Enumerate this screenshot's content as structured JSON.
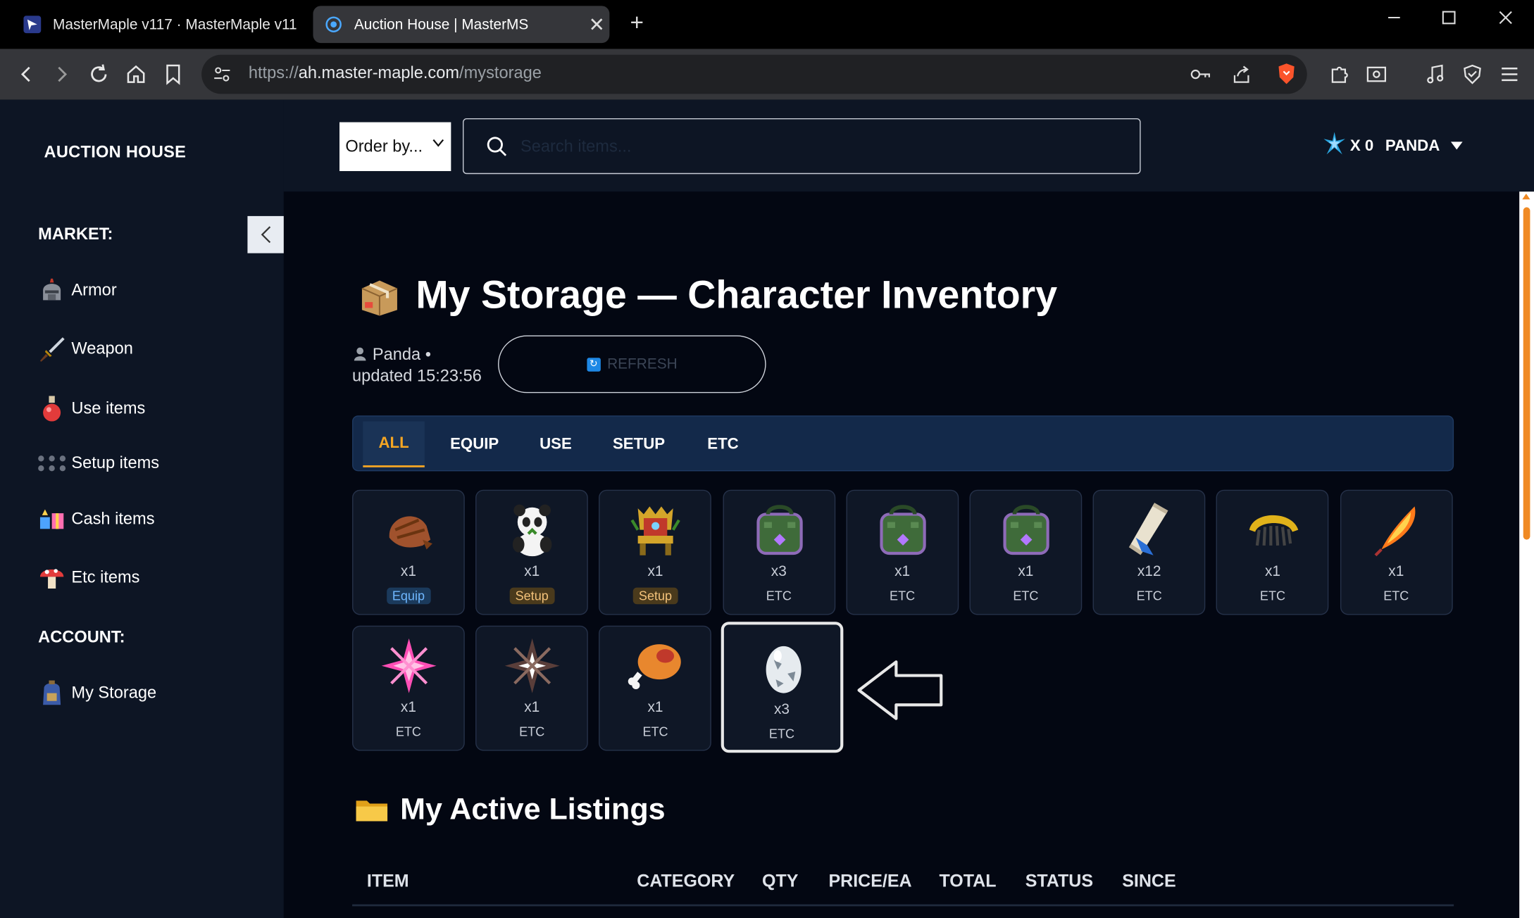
{
  "browser": {
    "tabs": [
      {
        "title": "MasterMaple v117 · MasterMaple v11"
      },
      {
        "title": "Auction House | MasterMS",
        "close": "✕"
      }
    ],
    "new_tab": "+",
    "url_scheme": "https://",
    "url_host": "ah.master-maple.com",
    "url_path": "/mystorage"
  },
  "sidebar": {
    "brand": "AUCTION HOUSE",
    "market_heading": "MARKET:",
    "market_items": [
      {
        "label": "Armor",
        "icon": "helmet-icon"
      },
      {
        "label": "Weapon",
        "icon": "sword-icon"
      },
      {
        "label": "Use items",
        "icon": "potion-icon"
      },
      {
        "label": "Setup items",
        "icon": "dots-icon"
      },
      {
        "label": "Cash items",
        "icon": "gift-icon"
      },
      {
        "label": "Etc items",
        "icon": "mushroom-icon"
      }
    ],
    "account_heading": "ACCOUNT:",
    "account_items": [
      {
        "label": "My Storage",
        "icon": "backpack-icon"
      }
    ]
  },
  "topbar": {
    "order_by": "Order by...",
    "search_placeholder": "Search items...",
    "currency_count": "X 0",
    "username": "PANDA"
  },
  "storage": {
    "title": "My Storage — Character Inventory",
    "character": "Panda",
    "updated": "updated 15:23:56",
    "refresh_label": "REFRESH",
    "filter_tabs": [
      "ALL",
      "EQUIP",
      "USE",
      "SETUP",
      "ETC"
    ],
    "active_tab": "ALL",
    "items": [
      {
        "qty": "x1",
        "category": "Equip",
        "art": "leather-cap"
      },
      {
        "qty": "x1",
        "category": "Setup",
        "art": "panda-chair"
      },
      {
        "qty": "x1",
        "category": "Setup",
        "art": "throne"
      },
      {
        "qty": "x3",
        "category": "ETC",
        "art": "green-bag"
      },
      {
        "qty": "x1",
        "category": "ETC",
        "art": "green-bag"
      },
      {
        "qty": "x1",
        "category": "ETC",
        "art": "green-bag"
      },
      {
        "qty": "x12",
        "category": "ETC",
        "art": "scroll"
      },
      {
        "qty": "x1",
        "category": "ETC",
        "art": "comb"
      },
      {
        "qty": "x1",
        "category": "ETC",
        "art": "fire-feather"
      },
      {
        "qty": "x1",
        "category": "ETC",
        "art": "pink-crystal"
      },
      {
        "qty": "x1",
        "category": "ETC",
        "art": "dark-crystal"
      },
      {
        "qty": "x1",
        "category": "ETC",
        "art": "meat"
      },
      {
        "qty": "x3",
        "category": "ETC",
        "art": "egg"
      }
    ]
  },
  "listings": {
    "title": "My Active Listings",
    "columns": [
      "ITEM",
      "CATEGORY",
      "QTY",
      "PRICE/EA",
      "TOTAL",
      "STATUS",
      "SINCE"
    ]
  },
  "colors": {
    "accent": "#f5a623",
    "sidebar_bg": "#0d1524",
    "main_bg": "#030712",
    "tab_bar_bg": "#13294a"
  }
}
